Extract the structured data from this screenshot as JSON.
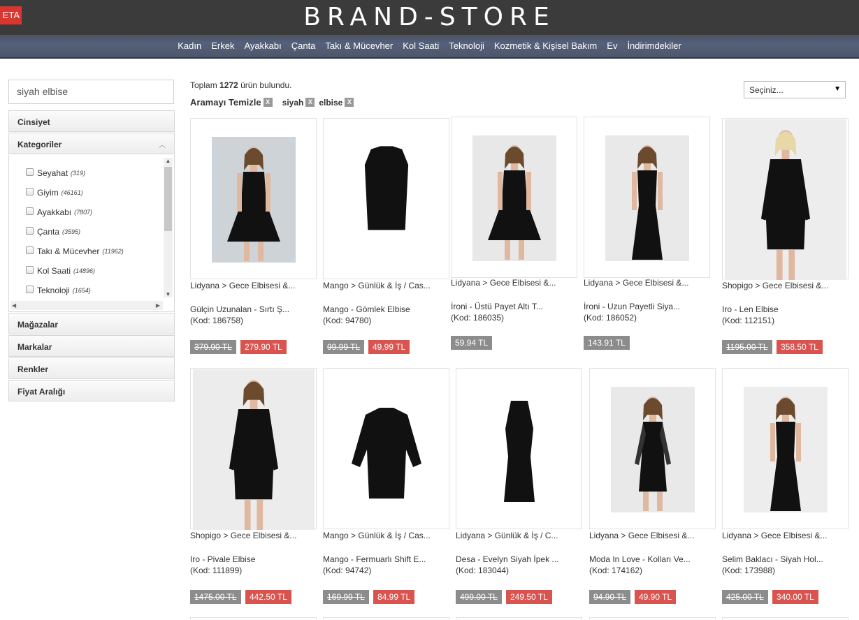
{
  "header": {
    "beta_label": "ETA",
    "logo": "BRAND-STORE",
    "nav": [
      "Kadın",
      "Erkek",
      "Ayakkabı",
      "Çanta",
      "Takı & Mücevher",
      "Kol Saati",
      "Teknoloji",
      "Kozmetik & Kişisel Bakım",
      "Ev",
      "İndirimdekiler"
    ]
  },
  "sidebar": {
    "search_value": "siyah elbise",
    "facets": {
      "cinsiyet": "Cinsiyet",
      "kategoriler": "Kategoriler",
      "magazalar": "Mağazalar",
      "markalar": "Markalar",
      "renkler": "Renkler",
      "fiyat": "Fiyat Aralığı"
    },
    "categories": [
      {
        "label": "Seyahat",
        "count": "(319)"
      },
      {
        "label": "Giyim",
        "count": "(46161)"
      },
      {
        "label": "Ayakkabı",
        "count": "(7807)"
      },
      {
        "label": "Çanta",
        "count": "(3595)"
      },
      {
        "label": "Takı & Mücevher",
        "count": "(11962)"
      },
      {
        "label": "Kol Saati",
        "count": "(14896)"
      },
      {
        "label": "Teknoloji",
        "count": "(1654)"
      }
    ]
  },
  "results": {
    "prefix": "Toplam",
    "count": "1272",
    "suffix": "ürün bulundu.",
    "clear_label": "Aramayı Temizle",
    "x": "X",
    "chips": [
      "siyah",
      "elbise"
    ],
    "sort_label": "Seçiniz...",
    "sort_caret": "▼"
  },
  "products": [
    {
      "cat": "Lidyana > Gece Elbisesi &...",
      "name": "Gülçin Uzunalan - Sırtı Ş...",
      "code": "(Kod: 186758)",
      "old": "379.90 TL",
      "price": "279.90 TL"
    },
    {
      "cat": "Mango > Günlük & İş / Cas...",
      "name": "Mango - Gömlek Elbise",
      "code": "(Kod: 94780)",
      "old": "99.99 TL",
      "price": "49.99 TL"
    },
    {
      "cat": "Lidyana > Gece Elbisesi &...",
      "name": "İroni - Üstü Payet Altı T...",
      "code": "(Kod: 186035)",
      "old": "",
      "price": "59.94 TL"
    },
    {
      "cat": "Lidyana > Gece Elbisesi &...",
      "name": "İroni - Uzun Payetli Siya...",
      "code": "(Kod: 186052)",
      "old": "",
      "price": "143.91 TL"
    },
    {
      "cat": "Shopigo > Gece Elbisesi &...",
      "name": "Iro - Len Elbise",
      "code": "(Kod: 112151)",
      "old": "1195.00 TL",
      "price": "358.50 TL"
    },
    {
      "cat": "Shopigo > Gece Elbisesi &...",
      "name": "Iro - Pivale Elbise",
      "code": "(Kod: 111899)",
      "old": "1475.00 TL",
      "price": "442.50 TL"
    },
    {
      "cat": "Mango > Günlük & İş / Cas...",
      "name": "Mango - Fermuarlı Shift E...",
      "code": "(Kod: 94742)",
      "old": "169.99 TL",
      "price": "84.99 TL"
    },
    {
      "cat": "Lidyana > Günlük & İş / C...",
      "name": "Desa - Evelyn Siyah İpek ...",
      "code": "(Kod: 183044)",
      "old": "499.00 TL",
      "price": "249.50 TL"
    },
    {
      "cat": "Lidyana > Gece Elbisesi &...",
      "name": "Moda In Love - Kolları Ve...",
      "code": "(Kod: 174162)",
      "old": "94.90 TL",
      "price": "49.90 TL"
    },
    {
      "cat": "Lidyana > Gece Elbisesi &...",
      "name": "Selim Baklacı - Siyah Hol...",
      "code": "(Kod: 173988)",
      "old": "425.00 TL",
      "price": "340.00 TL"
    }
  ]
}
